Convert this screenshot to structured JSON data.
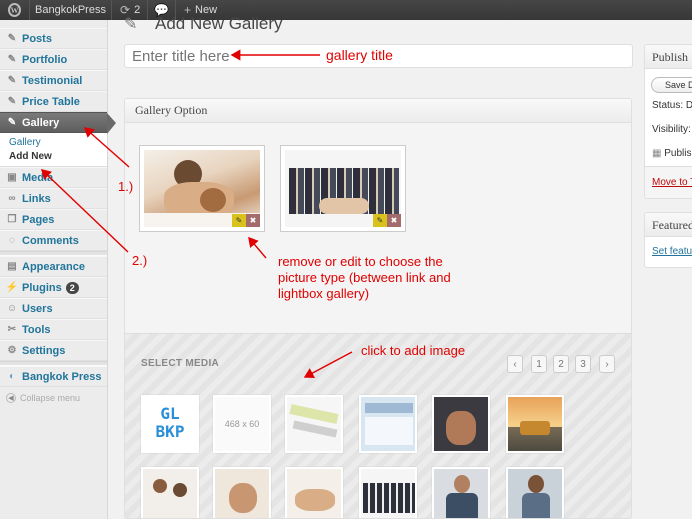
{
  "admin_bar": {
    "site_name": "BangkokPress",
    "updates_count": "2",
    "new_label": "New"
  },
  "sidebar": {
    "items": [
      {
        "label": "Posts",
        "icon": "pin-icon"
      },
      {
        "label": "Portfolio",
        "icon": "pin-icon"
      },
      {
        "label": "Testimonial",
        "icon": "pin-icon"
      },
      {
        "label": "Price Table",
        "icon": "pin-icon"
      },
      {
        "label": "Gallery",
        "icon": "pin-icon"
      },
      {
        "label": "Media",
        "icon": "media-icon"
      },
      {
        "label": "Links",
        "icon": "link-icon"
      },
      {
        "label": "Pages",
        "icon": "page-icon"
      },
      {
        "label": "Comments",
        "icon": "comment-icon"
      },
      {
        "label": "Appearance",
        "icon": "appearance-icon"
      },
      {
        "label": "Plugins",
        "icon": "plugin-icon",
        "badge": "2"
      },
      {
        "label": "Users",
        "icon": "users-icon"
      },
      {
        "label": "Tools",
        "icon": "tools-icon"
      },
      {
        "label": "Settings",
        "icon": "settings-icon"
      },
      {
        "label": "Bangkok Press",
        "icon": "theme-icon"
      }
    ],
    "gallery_submenu": [
      "Gallery",
      "Add New"
    ],
    "collapse_label": "Collapse menu"
  },
  "main": {
    "page_title": "Add New Gallery",
    "title_placeholder": "Enter title here",
    "gallery_box_title": "Gallery Option",
    "select_media_title": "SELECT MEDIA",
    "pagination": [
      "‹",
      "1",
      "2",
      "3",
      "›"
    ],
    "media_thumb_1_text": "GL BKP",
    "media_thumb_2_text": "468 x 60"
  },
  "publish_box": {
    "title": "Publish",
    "save_draft": "Save Draft",
    "status": "Status: D",
    "visibility": "Visibility:",
    "publish_line": "Publish",
    "move_to_trash": "Move to T"
  },
  "featured_box": {
    "title": "Featured",
    "set_featured": "Set featur"
  },
  "annotations": {
    "gallery_title": "gallery title",
    "remove_edit": [
      "remove or edit to choose the",
      "picture type (between link and",
      "lightbox gallery)"
    ],
    "click_add": "click to add image",
    "step1": "1.)",
    "step2": "2.)"
  },
  "colors": {
    "annotation_red": "#e10000",
    "link_blue": "#21759b",
    "active_menu": "#6a6a6a",
    "admin_bar": "#464646"
  }
}
